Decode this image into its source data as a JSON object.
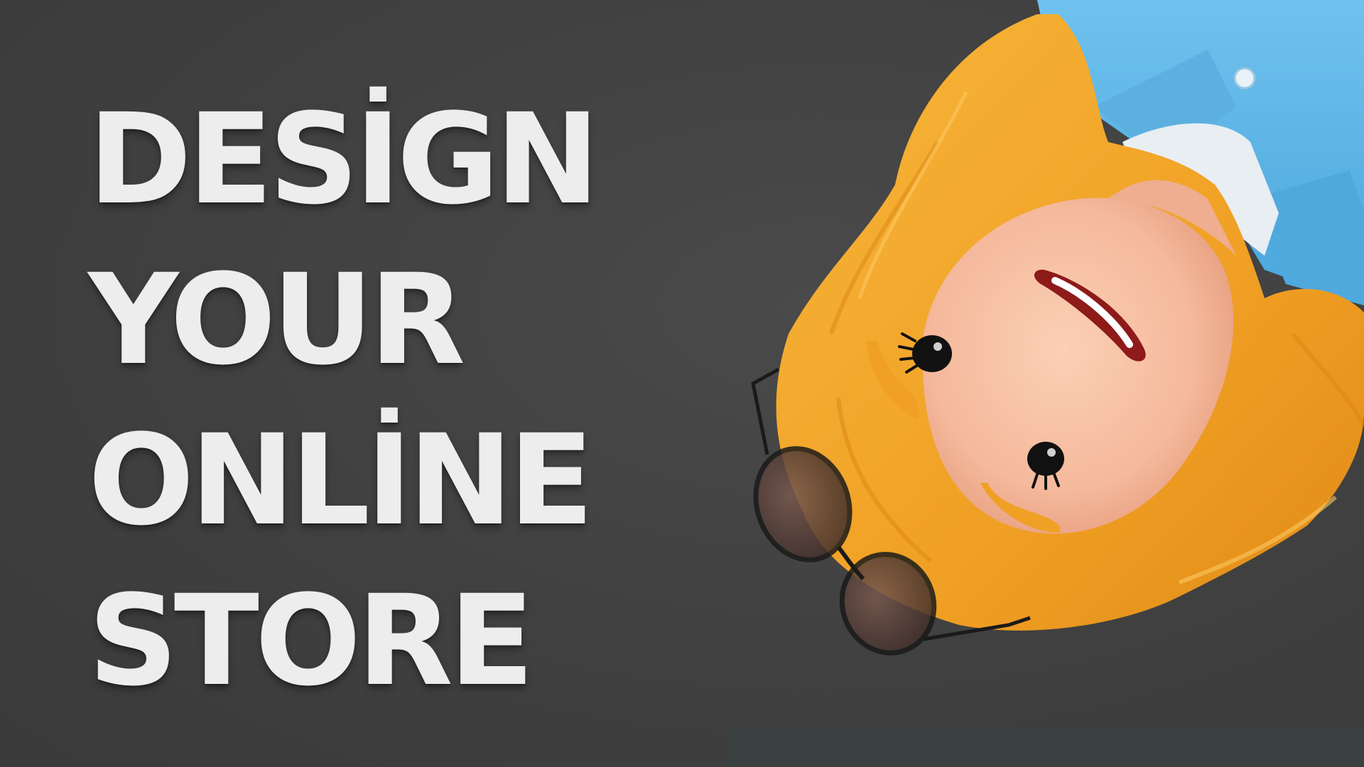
{
  "headline": {
    "lines": [
      "DESİGN",
      "YOUR",
      "ONLİNE",
      "STORE"
    ]
  },
  "colors": {
    "background": "#404040",
    "headline_text": "#ededed",
    "hair": "#f0a024",
    "skin": "#f5b99c",
    "shirt": "#5ab4e4",
    "collar": "#e8eef2",
    "glasses_frame": "#1a1a1a"
  },
  "illustration": {
    "subject": "upside-down 3D cartoon woman with orange hair, blue shirt and round sunglasses"
  }
}
